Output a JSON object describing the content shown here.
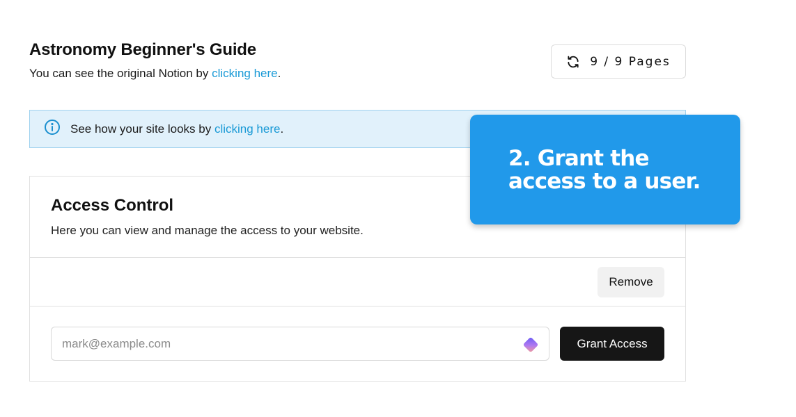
{
  "header": {
    "title": "Astronomy Beginner's Guide",
    "subtitle_prefix": "You can see the original Notion by ",
    "subtitle_link": "clicking here",
    "subtitle_suffix": ".",
    "pages_counter": "9 / 9 Pages",
    "refresh_icon": "refresh-icon"
  },
  "banner": {
    "icon": "info-icon",
    "text_prefix": "See how your site looks by ",
    "link": "clicking here",
    "text_suffix": "."
  },
  "access_control": {
    "title": "Access Control",
    "description": "Here you can view and manage the access to your website.",
    "remove_label": "Remove",
    "email_placeholder": "mark@example.com",
    "email_value": "",
    "grant_label": "Grant Access",
    "input_icon": "gem-icon"
  },
  "callout": {
    "text": "2. Grant the\naccess to a user."
  },
  "colors": {
    "link": "#1a9ad6",
    "banner_bg": "#e1f1fb",
    "banner_border": "#9fd2ef",
    "callout_bg": "#2199ea",
    "grant_button_bg": "#161616",
    "remove_button_bg": "#f1f1f1"
  }
}
